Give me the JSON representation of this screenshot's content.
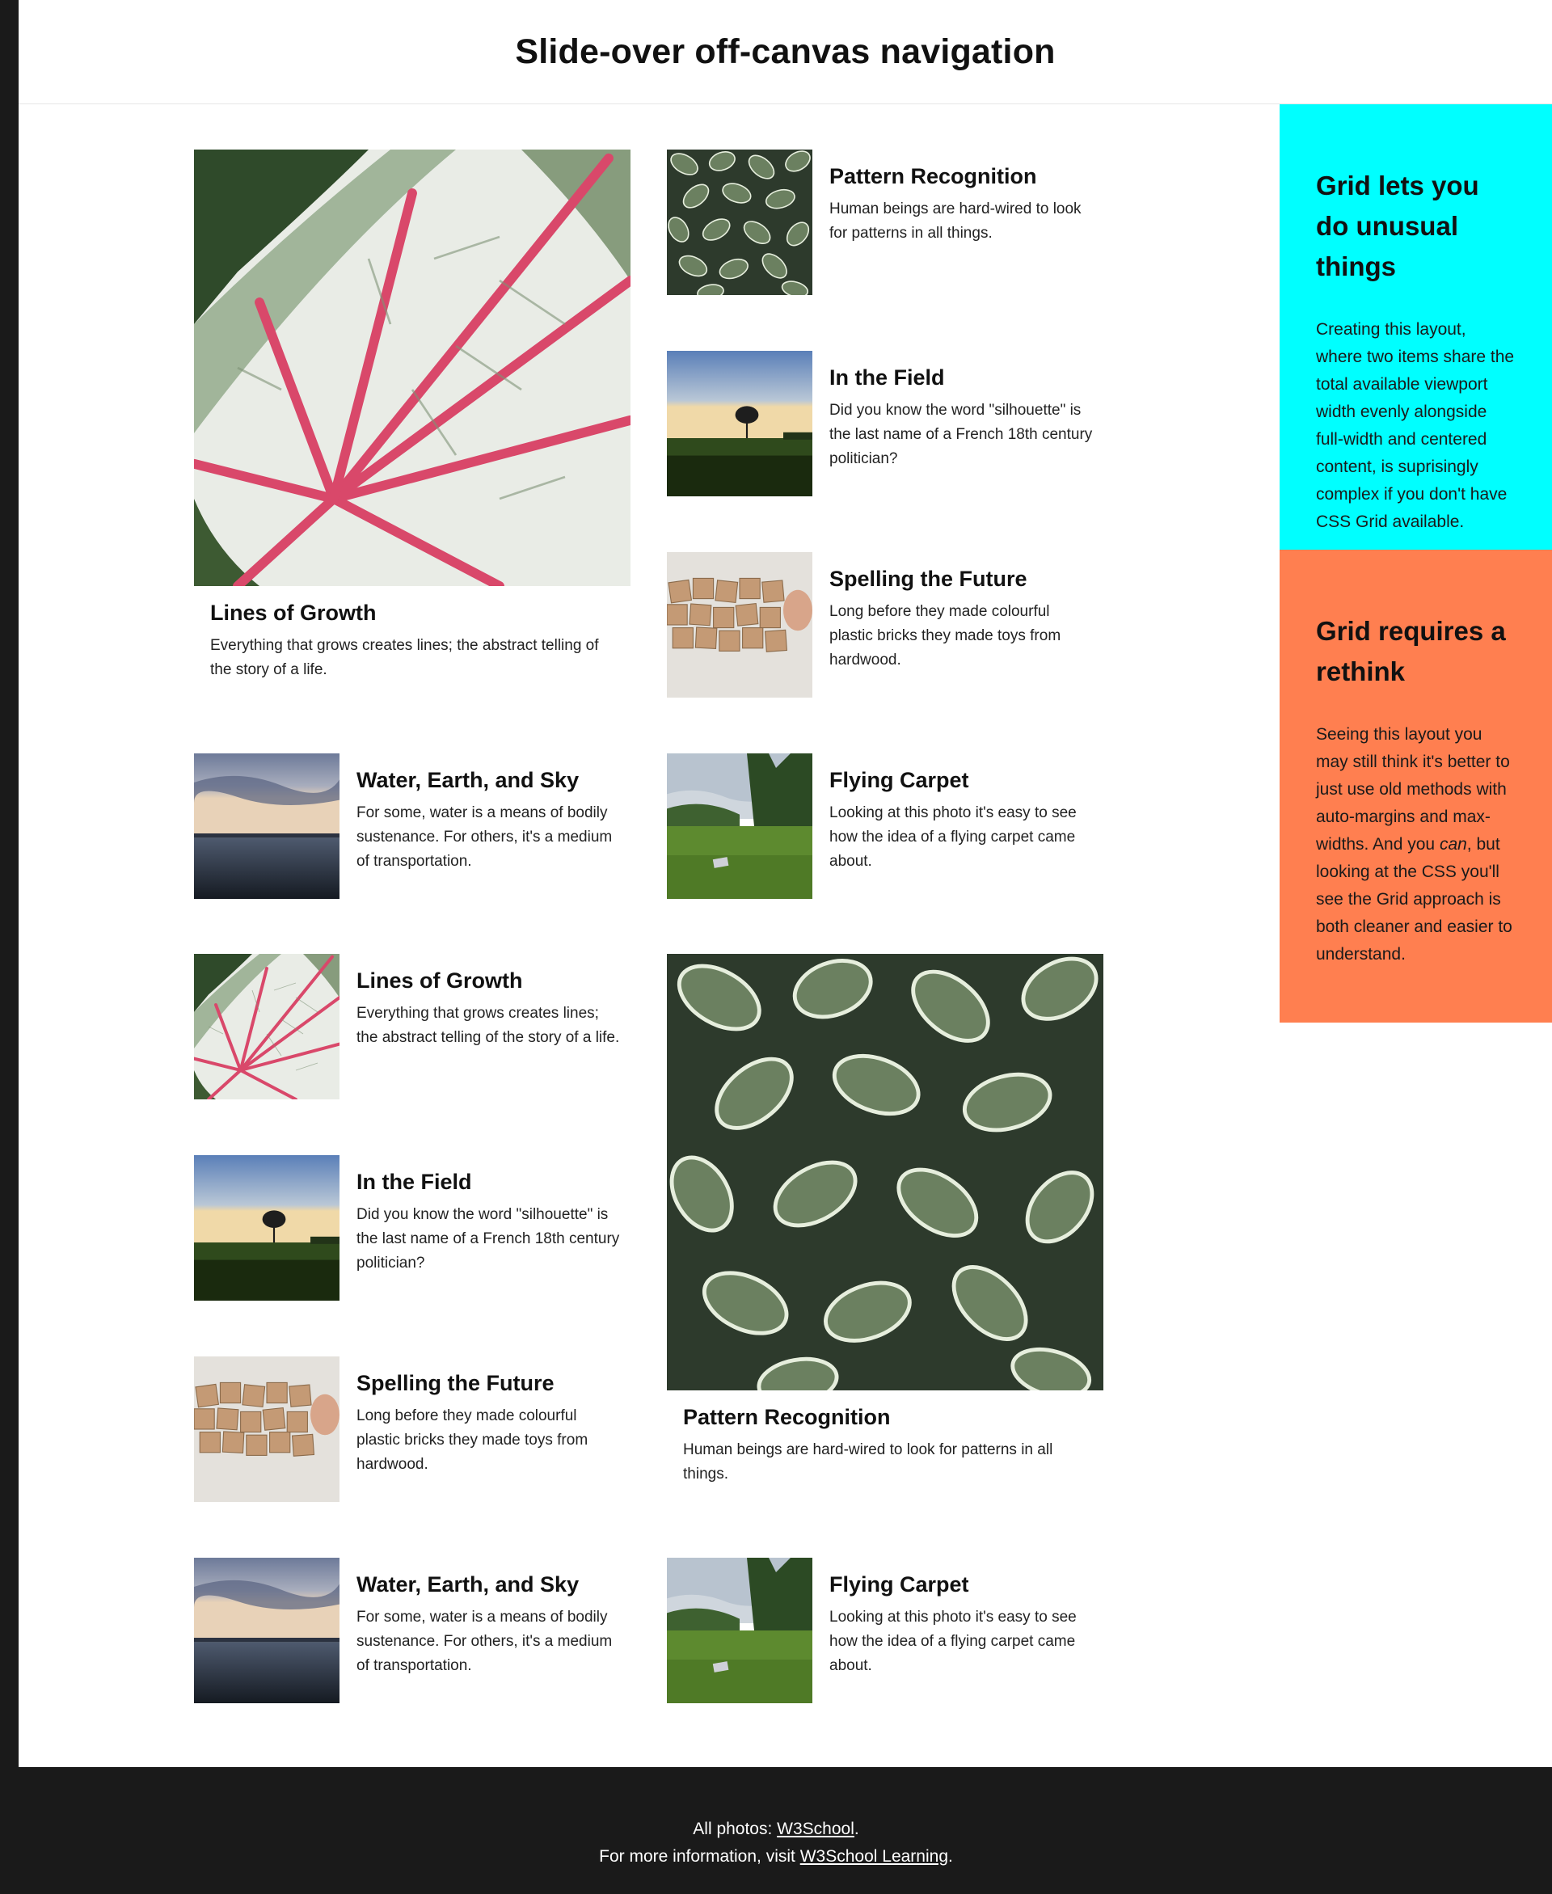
{
  "header": {
    "title": "Slide-over off-canvas navigation"
  },
  "cards": {
    "featured_growth": {
      "title": "Lines of Growth",
      "text": "Everything that grows creates lines; the abstract telling of the story of a life."
    },
    "pattern1": {
      "title": "Pattern Recognition",
      "text": "Human beings are hard-wired to look for patterns in all things."
    },
    "field1": {
      "title": "In the Field",
      "text": "Did you know the word \"silhouette\" is the last name of a French 18th century politician?"
    },
    "spelling1": {
      "title": "Spelling the Future",
      "text": "Long before they made colourful plastic bricks they made toys from hardwood."
    },
    "water1": {
      "title": "Water, Earth, and Sky",
      "text": "For some, water is a means of bodily sustenance. For others, it's a medium of transportation."
    },
    "carpet1": {
      "title": "Flying Carpet",
      "text": "Looking at this photo it's easy to see how the idea of a flying carpet came about."
    },
    "growth2": {
      "title": "Lines of Growth",
      "text": "Everything that grows creates lines; the abstract telling of the story of a life."
    },
    "featured_pattern": {
      "title": "Pattern Recognition",
      "text": "Human beings are hard-wired to look for patterns in all things."
    },
    "field2": {
      "title": "In the Field",
      "text": "Did you know the word \"silhouette\" is the last name of a French 18th century politician?"
    },
    "spelling2": {
      "title": "Spelling the Future",
      "text": "Long before they made colourful plastic bricks they made toys from hardwood."
    },
    "water2": {
      "title": "Water, Earth, and Sky",
      "text": "For some, water is a means of bodily sustenance. For others, it's a medium of transportation."
    },
    "carpet2": {
      "title": "Flying Carpet",
      "text": "Looking at this photo it's easy to see how the idea of a flying carpet came about."
    }
  },
  "aside": {
    "box1": {
      "title": "Grid lets you do unusual things",
      "text": "Creating this layout, where two items share the total available viewport width evenly alongside full-width and centered content, is suprisingly complex if you don't have CSS Grid available.",
      "color": "#00ffff"
    },
    "box2": {
      "title": "Grid requires a rethink",
      "text_before": "Seeing this layout you may still think it's better to just use old methods with auto-margins and max-widths. And you ",
      "text_em": "can",
      "text_after": ", but looking at the CSS you'll see the Grid approach is both cleaner and easier to understand.",
      "color": "#ff7f50"
    }
  },
  "footer": {
    "line1_prefix": "All photos: ",
    "line1_link": "W3School",
    "line1_suffix": ".",
    "line2_prefix": "For more information, visit ",
    "line2_link": "W3School Learning",
    "line2_suffix": "."
  },
  "icons": {
    "leaf": "caladium-leaf-photo",
    "pattern": "fittonia-leaves-photo",
    "field": "tree-silhouette-photo",
    "blocks": "wooden-blocks-photo",
    "water": "lake-sky-photo",
    "carpet": "meadow-blanket-photo"
  }
}
